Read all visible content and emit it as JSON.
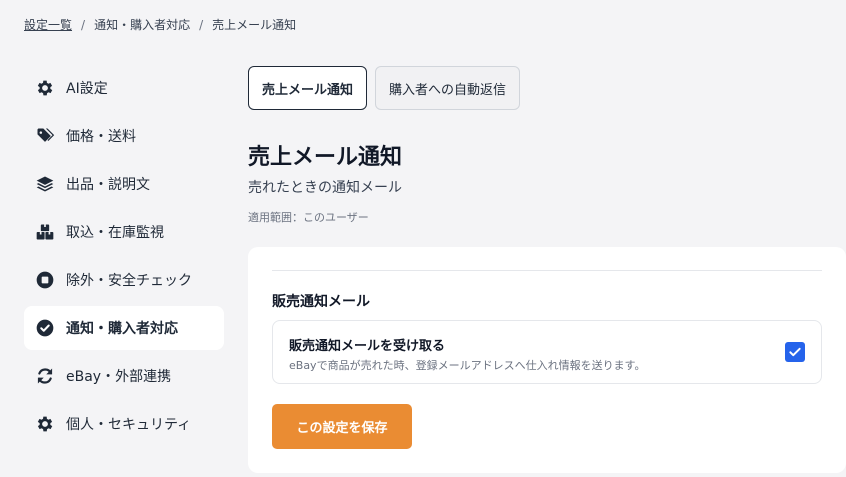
{
  "breadcrumb": {
    "items": [
      "設定一覧",
      "通知・購入者対応",
      "売上メール通知"
    ],
    "separator": "/"
  },
  "sidebar": {
    "items": [
      {
        "label": "AI設定",
        "icon": "gear-icon"
      },
      {
        "label": "価格・送料",
        "icon": "tag-icon"
      },
      {
        "label": "出品・説明文",
        "icon": "layers-icon"
      },
      {
        "label": "取込・在庫監視",
        "icon": "boxes-icon"
      },
      {
        "label": "除外・安全チェック",
        "icon": "stop-circle-icon"
      },
      {
        "label": "通知・購入者対応",
        "icon": "check-circle-icon",
        "active": true
      },
      {
        "label": "eBay・外部連携",
        "icon": "sync-icon"
      },
      {
        "label": "個人・セキュリティ",
        "icon": "gear-icon"
      }
    ]
  },
  "tabs": [
    {
      "label": "売上メール通知",
      "active": true
    },
    {
      "label": "購入者への自動返信",
      "active": false
    }
  ],
  "main": {
    "title": "売上メール通知",
    "subtitle": "売れたときの通知メール",
    "scope": "適用範囲：このユーザー"
  },
  "card": {
    "section_title": "販売通知メール",
    "option": {
      "title": "販売通知メールを受け取る",
      "description": "eBayで商品が売れた時、登録メールアドレスへ仕入れ情報を送ります。",
      "checked": true
    },
    "save_label": "この設定を保存"
  },
  "colors": {
    "accent": "#ea8c33",
    "checkbox": "#2563eb",
    "background": "#f4f4f6"
  }
}
